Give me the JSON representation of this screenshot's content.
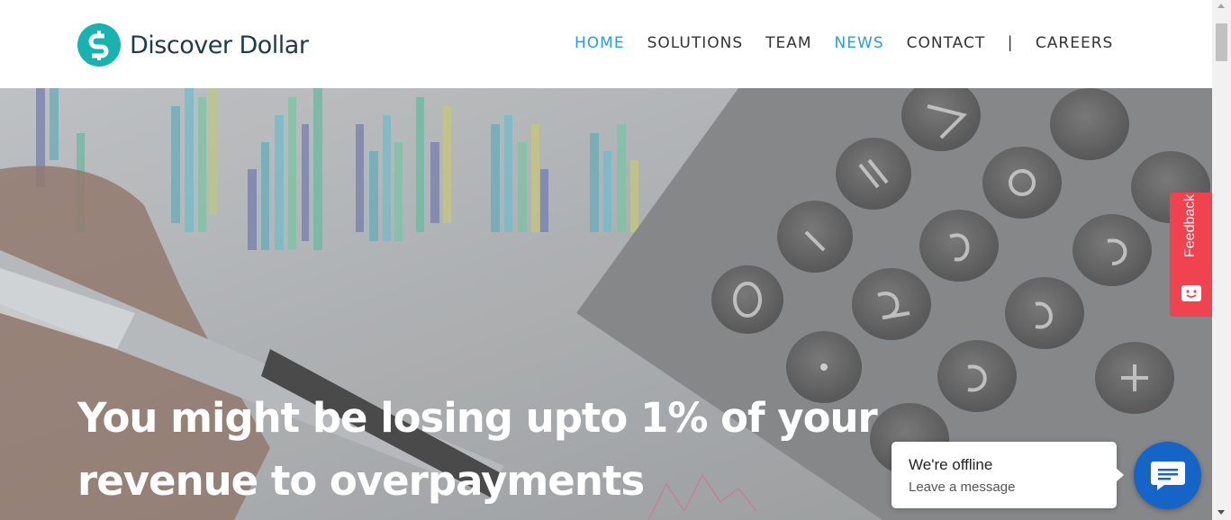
{
  "brand": {
    "name": "Discover Dollar",
    "accent": "#16b3b0",
    "text_color": "#1e3a4c"
  },
  "nav": {
    "items": [
      {
        "label": "HOME",
        "active": true
      },
      {
        "label": "SOLUTIONS",
        "active": false
      },
      {
        "label": "TEAM",
        "active": false
      },
      {
        "label": "NEWS",
        "active": true
      },
      {
        "label": "CONTACT",
        "active": false
      },
      {
        "label": "CAREERS",
        "active": false
      }
    ],
    "separator": "|",
    "active_color": "#2a9fd6"
  },
  "hero": {
    "headline_line1": "You might be losing upto 1% of your",
    "headline_line2": "revenue to overpayments"
  },
  "feedback": {
    "label": "Feedback",
    "color": "#f0434f",
    "icon": "smile-face-icon"
  },
  "chat": {
    "status": "We're offline",
    "action": "Leave a message",
    "button_color": "#1565c8",
    "icon": "chat-bubble-icon"
  }
}
